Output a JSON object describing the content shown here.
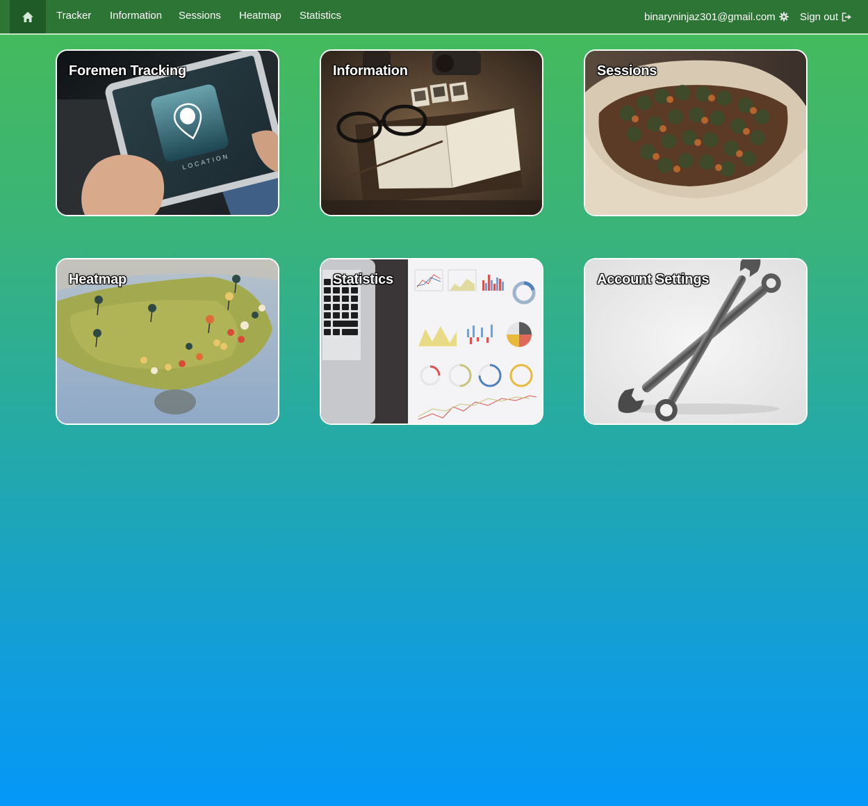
{
  "navbar": {
    "home_icon": "home-icon",
    "links": [
      "Tracker",
      "Information",
      "Sessions",
      "Heatmap",
      "Statistics"
    ],
    "user_email": "binaryninjaz301@gmail.com",
    "settings_icon": "gear-icon",
    "sign_out_label": "Sign out",
    "sign_out_icon": "log-out-icon"
  },
  "cards": [
    {
      "title": "Foremen Tracking",
      "image": "tablet-location-photo"
    },
    {
      "title": "Information",
      "image": "glasses-notebook-photo"
    },
    {
      "title": "Sessions",
      "image": "nuts-in-sack-photo"
    },
    {
      "title": "Heatmap",
      "image": "map-with-pins-photo"
    },
    {
      "title": "Statistics",
      "image": "laptop-charts-photo"
    },
    {
      "title": "Account Settings",
      "image": "wrenches-photo"
    }
  ],
  "colors": {
    "navbar": "#2c7535",
    "home_active": "#1e5b27",
    "gradient_top": "#46bb58",
    "gradient_bottom": "#0498f8"
  }
}
